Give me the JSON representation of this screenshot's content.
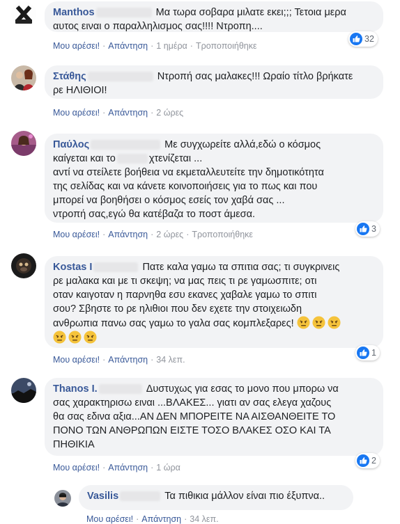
{
  "labels": {
    "like": "Μου αρέσει!",
    "reply": "Απάντηση"
  },
  "comments": [
    {
      "author": "Manthos",
      "lines": [
        "Μα τωρα σοβαρα μιλατε εκει;;; Τετοια μερα",
        "αυτος ειναι ο παραλληλισμος σας!!!! Ντροπη...."
      ],
      "time": "1 ημέρα",
      "edited": "Τροποποιήθηκε",
      "reactions": "32"
    },
    {
      "author": "Στάθης",
      "lines": [
        "Ντροπή σας μαλακες!!! Ωραίο τίτλο βρήκατε",
        "ρε ΗΛΙΘΙΟΙ!"
      ],
      "time": "2 ώρες"
    },
    {
      "author": "Παύλος",
      "lines": [
        "Με συγχωρείτε αλλά,εδώ ο κόσμος",
        "καίγεται και το",
        "χτενίζεται ...",
        "αντί να στείλετε βοήθεια να εκμεταλλευτείτε την δημοτικότητα",
        "της σελίδας και να κάνετε κοινοποιήσεις για το πως και που",
        "μπορεί να βοηθήσει ο κόσμος εσείς τον χαβά σας ...",
        "ντροπή σας,εγώ θα κατέβαζα το ποστ άμεσα."
      ],
      "time": "2 ώρες",
      "edited": "Τροποποιήθηκε",
      "reactions": "3"
    },
    {
      "author": "Kostas I",
      "lines": [
        "Πατε καλα γαμω τα σπιτια σας; τι συγκρινεις",
        "ρε μαλακα και με τι σκεψη; να μας πεις τι ρε γαμωσπιτε; οτι",
        "οταν καιγοταν η παρνηθα εσυ εκανες χαβαλε γαμω το σπιτι",
        "σου? Σβηστε το ρε ηλιθιοι που δεν εχετε την στοιχειωδη",
        "ανθρωπια πανω σας γαμω το γαλα σας κομπλεξαρες!"
      ],
      "time": "34 λεπ.",
      "reactions": "1"
    },
    {
      "author": "Thanos I.",
      "lines": [
        "Δυστυχως για εσας το μονο που μπορω να",
        "σας χαρακτηρισω ειναι ...ΒΛΑΚΕΣ... γιατι αν σας ελεγα χαζους",
        "θα σας εδινα αξια...ΑΝ ΔΕΝ ΜΠΟΡΕΙΤΕ ΝΑ ΑΙΣΘΑΝΘΕΙΤΕ ΤΟ",
        "ΠΟΝΟ ΤΩΝ ΑΝΘΡΩΠΩΝ ΕΙΣΤΕ ΤΟΣΟ ΒΛΑΚΕΣ ΟΣΟ ΚΑΙ ΤΑ",
        "ΠΗΘΙΚΙΑ"
      ],
      "time": "1 ώρα",
      "reactions": "2"
    },
    {
      "author": "Vasilis",
      "lines": [
        "Τα πιθικια μάλλον είναι πιο έξυπνα.."
      ],
      "time": "34 λεπ."
    }
  ],
  "icons": {
    "like": "like-thumb-icon",
    "angry": "angry-emoji-icon"
  },
  "colors": {
    "link": "#385898",
    "bubble": "#f2f3f5",
    "like_blue": "#1877f2",
    "angry": "#f5c33b"
  }
}
